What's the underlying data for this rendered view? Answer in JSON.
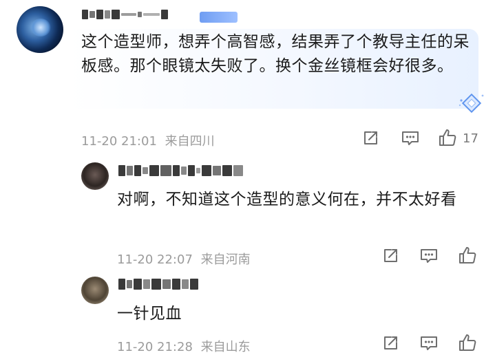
{
  "comment": {
    "text": "这个造型师，想弄个高智感，结果弄了个教导主任的呆板感。那个眼镜太失败了。换个金丝镜框会好很多。",
    "time": "11-20 21:01",
    "location": "来自四川",
    "like_count": "17"
  },
  "replies": [
    {
      "text": "对啊，不知道这个造型的意义何在，并不太好看",
      "time": "11-20 22:07",
      "location": "来自河南"
    },
    {
      "text": "一针见血",
      "time": "11-20 21:28",
      "location": "来自山东"
    }
  ],
  "icons": {
    "share": "share-icon",
    "reply": "comment-icon",
    "like": "thumbs-up-icon",
    "decor": "diamond-sparkle-icon"
  },
  "colors": {
    "text": "#1b1b1b",
    "meta": "#9b9b9b",
    "icon": "#6e6e6e",
    "badge": "#7aa6f5",
    "bubble": "#eaf2ff"
  }
}
